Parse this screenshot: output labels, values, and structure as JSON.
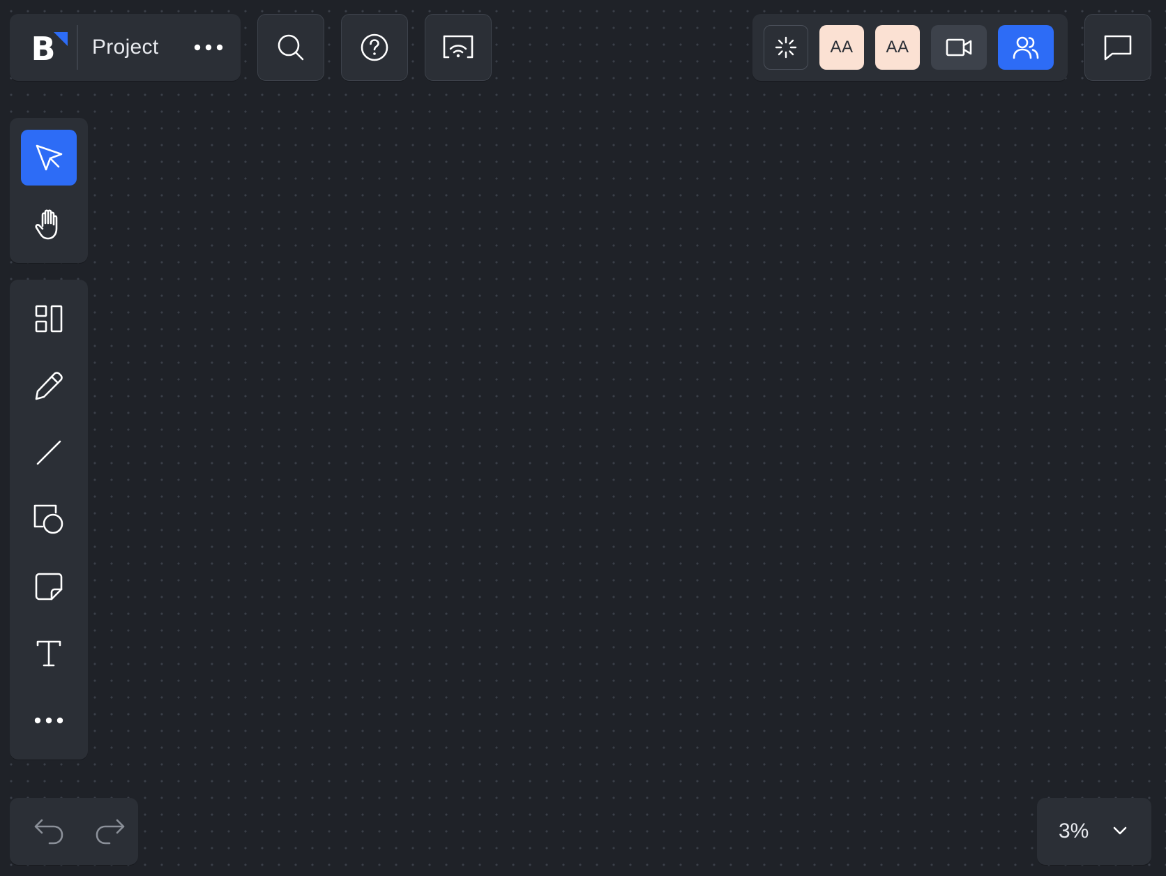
{
  "header": {
    "logo_letter": "B",
    "project_title": "Project"
  },
  "collaborators": {
    "avatar_1_initials": "AA",
    "avatar_2_initials": "AA"
  },
  "zoom": {
    "level": "3%"
  },
  "colors": {
    "canvas_background": "#1f2228",
    "panel_background": "#2b2f36",
    "accent_blue": "#2d6cf6",
    "avatar_background": "#fbe1d3"
  },
  "icons": {
    "header": [
      "project-menu-icon",
      "search-icon",
      "help-icon",
      "cast-icon"
    ],
    "collab": [
      "spark-icon",
      "video-camera-icon",
      "people-icon",
      "comment-icon"
    ],
    "tools": [
      "cursor-icon",
      "hand-icon",
      "templates-icon",
      "pen-icon",
      "line-icon",
      "shapes-icon",
      "sticky-note-icon",
      "text-icon",
      "more-icon"
    ],
    "history": [
      "undo-icon",
      "redo-icon"
    ],
    "zoom": [
      "chevron-down-icon"
    ]
  }
}
